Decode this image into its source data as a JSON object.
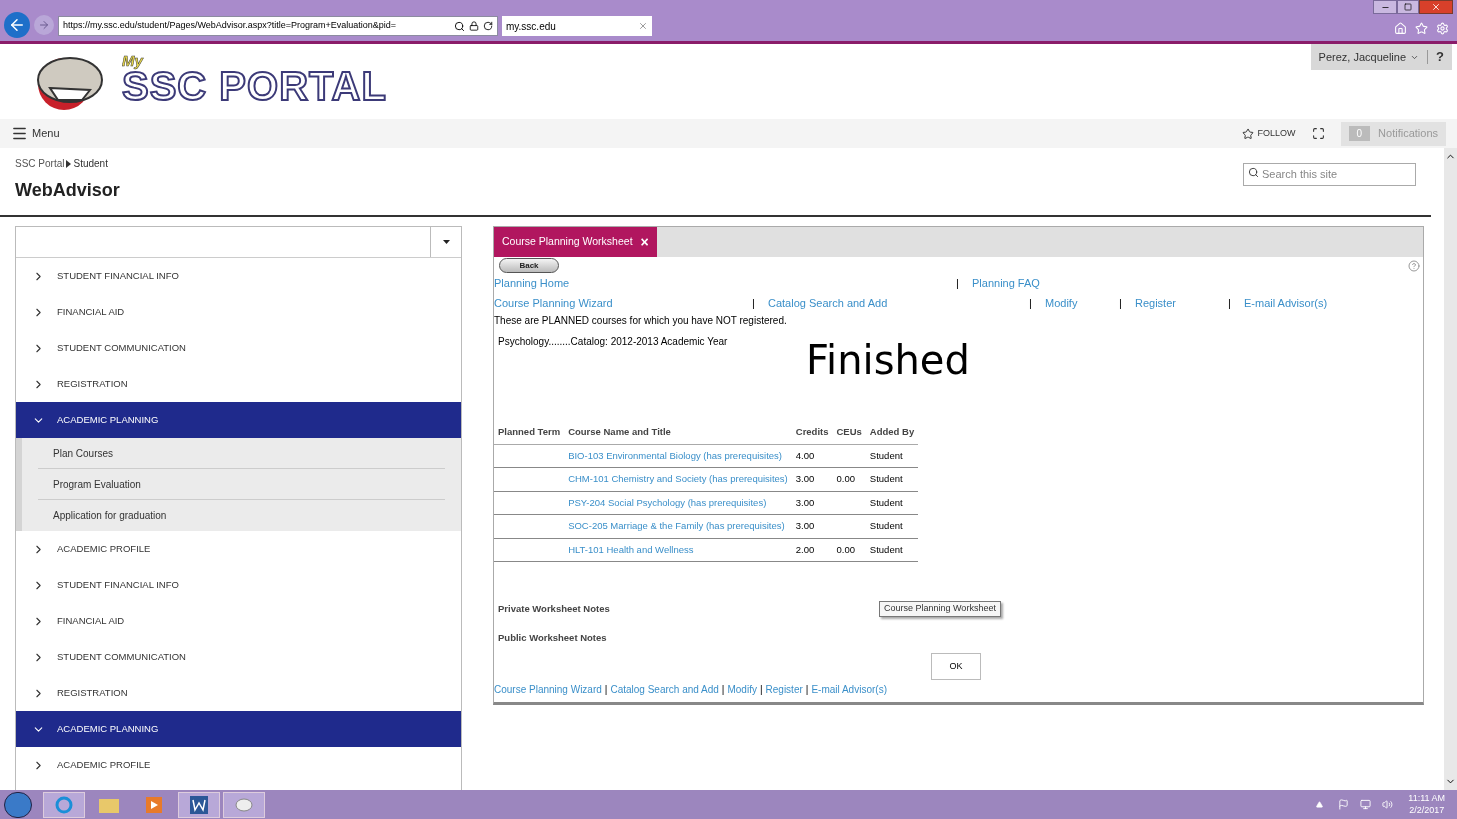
{
  "browser": {
    "address": "https://my.ssc.edu/student/Pages/WebAdvisor.aspx?title=Program+Evaluation&pid=",
    "tabs": [
      {
        "label": "my.ssc.edu",
        "selected": true
      }
    ]
  },
  "header": {
    "logo_small": "My",
    "logo_text": "SSC PORTAL",
    "user": "Perez, Jacqueline",
    "help": "?",
    "menu": "Menu",
    "follow": "FOLLOW",
    "notifications_count": "0",
    "notifications": "Notifications"
  },
  "breadcrumb": [
    "SSC Portal",
    "Student"
  ],
  "page_title": "WebAdvisor",
  "search": {
    "placeholder": "Search this site"
  },
  "sidebar": {
    "items": [
      {
        "label": "STUDENT FINANCIAL INFO",
        "expanded": false
      },
      {
        "label": "FINANCIAL AID",
        "expanded": false
      },
      {
        "label": "STUDENT COMMUNICATION",
        "expanded": false
      },
      {
        "label": "REGISTRATION",
        "expanded": false
      },
      {
        "label": "ACADEMIC PLANNING",
        "expanded": true,
        "children": [
          {
            "label": "Plan Courses"
          },
          {
            "label": "Program Evaluation"
          },
          {
            "label": "Application for graduation"
          }
        ]
      },
      {
        "label": "ACADEMIC PROFILE",
        "expanded": false
      },
      {
        "label": "STUDENT FINANCIAL INFO",
        "expanded": false
      },
      {
        "label": "FINANCIAL AID",
        "expanded": false
      },
      {
        "label": "STUDENT COMMUNICATION",
        "expanded": false
      },
      {
        "label": "REGISTRATION",
        "expanded": false
      },
      {
        "label": "ACADEMIC PLANNING",
        "expanded": true
      },
      {
        "label": "ACADEMIC PROFILE",
        "expanded": false
      }
    ]
  },
  "panel": {
    "tab": {
      "label": "Course Planning Worksheet",
      "close": "×"
    },
    "back": "Back",
    "separator": "|",
    "links_top": [
      "Planning Home",
      "Planning FAQ"
    ],
    "links_main": [
      "Course Planning Wizard",
      "Catalog Search and Add",
      "Modify",
      "Register",
      "E-mail Advisor(s)"
    ],
    "intro": "These are PLANNED courses for which you have NOT registered.",
    "program": "Psychology........Catalog: 2012-2013 Academic Year",
    "handwritten": "Finished",
    "table": {
      "columns": [
        "Planned Term",
        "Course Name and Title",
        "Credits",
        "CEUs",
        "Added By"
      ],
      "rows": [
        {
          "course": "BIO-103 Environmental Biology (has prerequisites)",
          "credits": "4.00",
          "added_by": "Student"
        },
        {
          "course": "CHM-101 Chemistry and Society (has prerequisites)",
          "credits": "3.00",
          "ceus": "0.00",
          "added_by": "Student"
        },
        {
          "course": "PSY-204 Social Psychology (has prerequisites)",
          "credits": "3.00",
          "added_by": "Student"
        },
        {
          "course": "SOC-205 Marriage & the Family (has prerequisites)",
          "credits": "3.00",
          "added_by": "Student"
        },
        {
          "course": "HLT-101 Health and Wellness",
          "credits": "2.00",
          "ceus": "0.00",
          "added_by": "Student"
        }
      ]
    },
    "private_notes": "Private Worksheet Notes",
    "tooltip": "Course Planning Worksheet",
    "public_notes": "Public Worksheet Notes",
    "ok": "OK",
    "links_bottom": [
      "Course Planning Wizard",
      "Catalog Search and Add",
      "Modify",
      "Register",
      "E-mail Advisor(s)"
    ]
  },
  "taskbar": {
    "time": "11:11 AM",
    "date": "2/2/2017"
  }
}
